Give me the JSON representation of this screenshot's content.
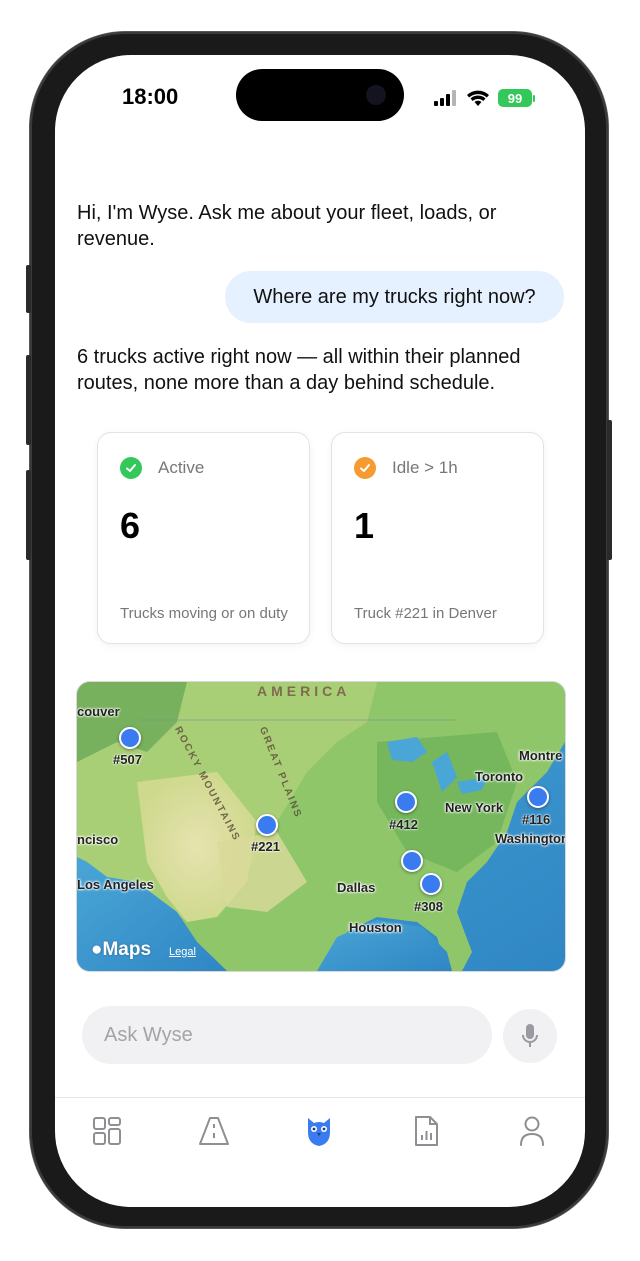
{
  "status": {
    "time": "18:00",
    "battery": "99"
  },
  "chat": {
    "assistant_intro": "Hi, I'm Wyse. Ask me about your fleet, loads, or revenue.",
    "user_question": "Where are my trucks right now?",
    "assistant_answer": "6 trucks active right now — all within their planned routes, none more than a day behind schedule."
  },
  "cards": [
    {
      "label": "Active",
      "value": "6",
      "description": "Trucks moving or on duty",
      "color": "#34c759"
    },
    {
      "label": "Idle > 1h",
      "value": "1",
      "description": "Truck #221 in Denver",
      "color": "#f59b2f"
    }
  ],
  "map": {
    "region_label": "AMERICA",
    "mountain_labels": [
      "ROCKY MOUNTAINS",
      "GREAT PLAINS"
    ],
    "cities": [
      "couver",
      "ncisco",
      "Los Angeles",
      "Dallas",
      "Houston",
      "Toronto",
      "Montre",
      "New York",
      "Washington"
    ],
    "trucks": [
      "#507",
      "#221",
      "#412",
      "#308",
      "#116"
    ],
    "brand": "Maps",
    "legal": "Legal"
  },
  "composer": {
    "placeholder": "Ask Wyse"
  },
  "tabs": [
    {
      "name": "dashboard",
      "icon": "grid-icon",
      "active": false
    },
    {
      "name": "roads",
      "icon": "road-icon",
      "active": false
    },
    {
      "name": "assistant",
      "icon": "owl-icon",
      "active": true
    },
    {
      "name": "reports",
      "icon": "report-icon",
      "active": false
    },
    {
      "name": "profile",
      "icon": "person-icon",
      "active": false
    }
  ],
  "colors": {
    "accent": "#3a7bf0",
    "bubble": "#e6f1ff"
  }
}
